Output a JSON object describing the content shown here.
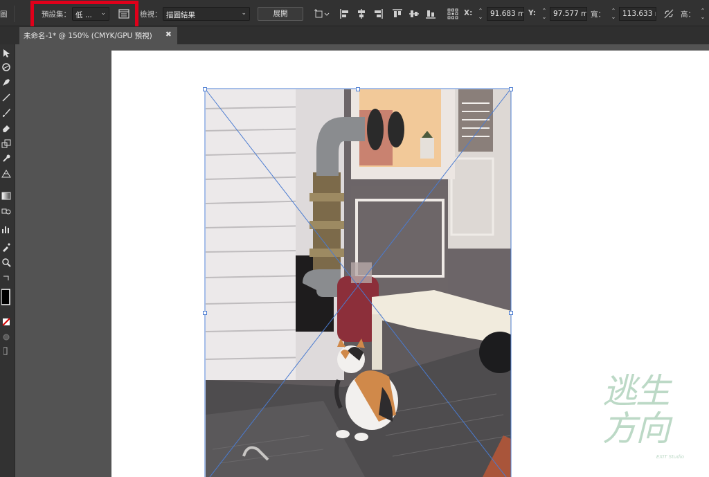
{
  "control_bar": {
    "left_fragment": "圖",
    "preset_label": "預設集：",
    "preset_value": "低 ...",
    "view_label": "檢視：",
    "view_value": "描圖結果",
    "expand_button": "展開",
    "x_label": "X:",
    "x_value": "91.683 m",
    "y_label": "Y:",
    "y_value": "97.577 m",
    "w_label": "寬：",
    "w_value": "113.633 r",
    "h_label": "高："
  },
  "tabs": [
    {
      "label": "未命名-1* @ 150% (CMYK/GPU 預視)",
      "close": "✖"
    }
  ],
  "tools": [
    "selection-tool",
    "direct-selection-tool",
    "pen-tool",
    "line-tool",
    "paintbrush-tool",
    "eraser-tool",
    "scale-tool",
    "puppet-warp-tool",
    "perspective-grid-tool",
    "gradient-tool",
    "blend-tool",
    "graph-tool",
    "eyedropper-tool",
    "zoom-tool",
    "swap-colors",
    "fill-stroke",
    "none-color",
    "draw-mode",
    "screen-mode"
  ],
  "watermark": {
    "text_top": "逃生",
    "text_bottom": "方向",
    "subtitle": "EXIT Studio"
  },
  "colors": {
    "highlight": "#e0001a",
    "selection": "#4a7bd1"
  }
}
